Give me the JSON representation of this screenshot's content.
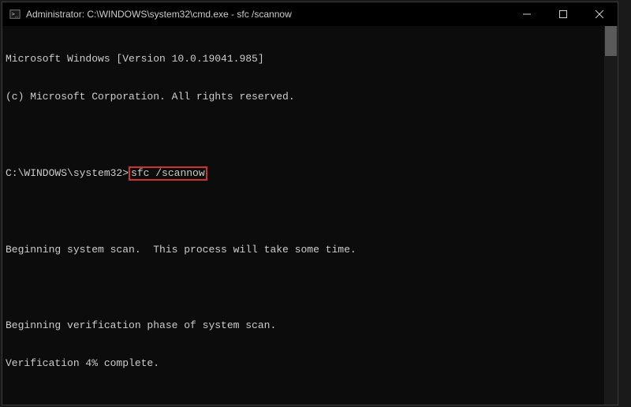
{
  "titlebar": {
    "title": "Administrator: C:\\WINDOWS\\system32\\cmd.exe - sfc  /scannow"
  },
  "terminal": {
    "line1": "Microsoft Windows [Version 10.0.19041.985]",
    "line2": "(c) Microsoft Corporation. All rights reserved.",
    "line3": "",
    "prompt": "C:\\WINDOWS\\system32>",
    "command": "sfc /scannow",
    "line5": "",
    "line6": "Beginning system scan.  This process will take some time.",
    "line7": "",
    "line8": "Beginning verification phase of system scan.",
    "line9": "Verification 4% complete."
  },
  "controls": {
    "minimize": "─",
    "maximize": "☐",
    "close": "✕"
  }
}
